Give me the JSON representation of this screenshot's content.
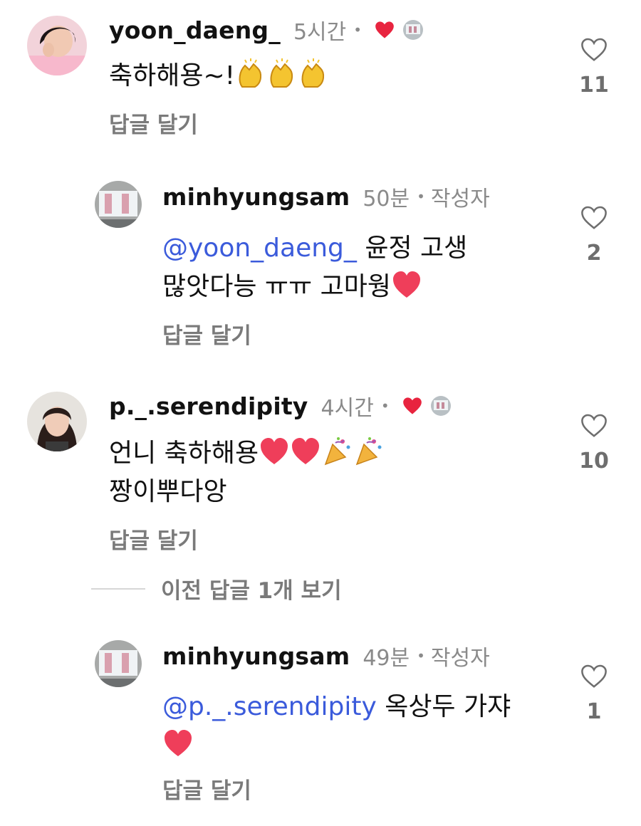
{
  "comments": [
    {
      "username": "yoon_daeng_",
      "time": "5시간",
      "dot": "•",
      "text": "축하해용~!",
      "reply_label": "답글 달기",
      "likes": "11",
      "avatar_icon": "profile-photo-woman-pink",
      "reactions": [
        "clapping-hands-emoji",
        "clapping-hands-emoji",
        "clapping-hands-emoji"
      ]
    },
    {
      "username": "minhyungsam",
      "time": "50분",
      "dot": "•",
      "author_label": "작성자",
      "mention": "@yoon_daeng_",
      "text_line1": " 윤정 고생",
      "text_line2": "많앗다능 ㅠㅠ  고마웡",
      "reply_label": "답글 달기",
      "likes": "2",
      "avatar_icon": "profile-photo-screen"
    },
    {
      "username": "p._.serendipity",
      "time": "4시간",
      "dot": "•",
      "text_line1": "언니 축하해용",
      "text_line2": "짱이뿌다앙",
      "reply_label": "답글 달기",
      "likes": "10",
      "avatar_icon": "profile-photo-woman-dark-hair"
    },
    {
      "username": "minhyungsam",
      "time": "49분",
      "dot": "•",
      "author_label": "작성자",
      "mention": "@p._.serendipity",
      "text_line1": " 옥상두 가쟈",
      "reply_label": "답글 달기",
      "likes": "1",
      "avatar_icon": "profile-photo-screen"
    }
  ],
  "view_previous": "이전 답글 1개 보기",
  "colors": {
    "mention": "#3b5bdb",
    "secondary_text": "#8a8a8a",
    "like_heart": "#e8243f"
  }
}
